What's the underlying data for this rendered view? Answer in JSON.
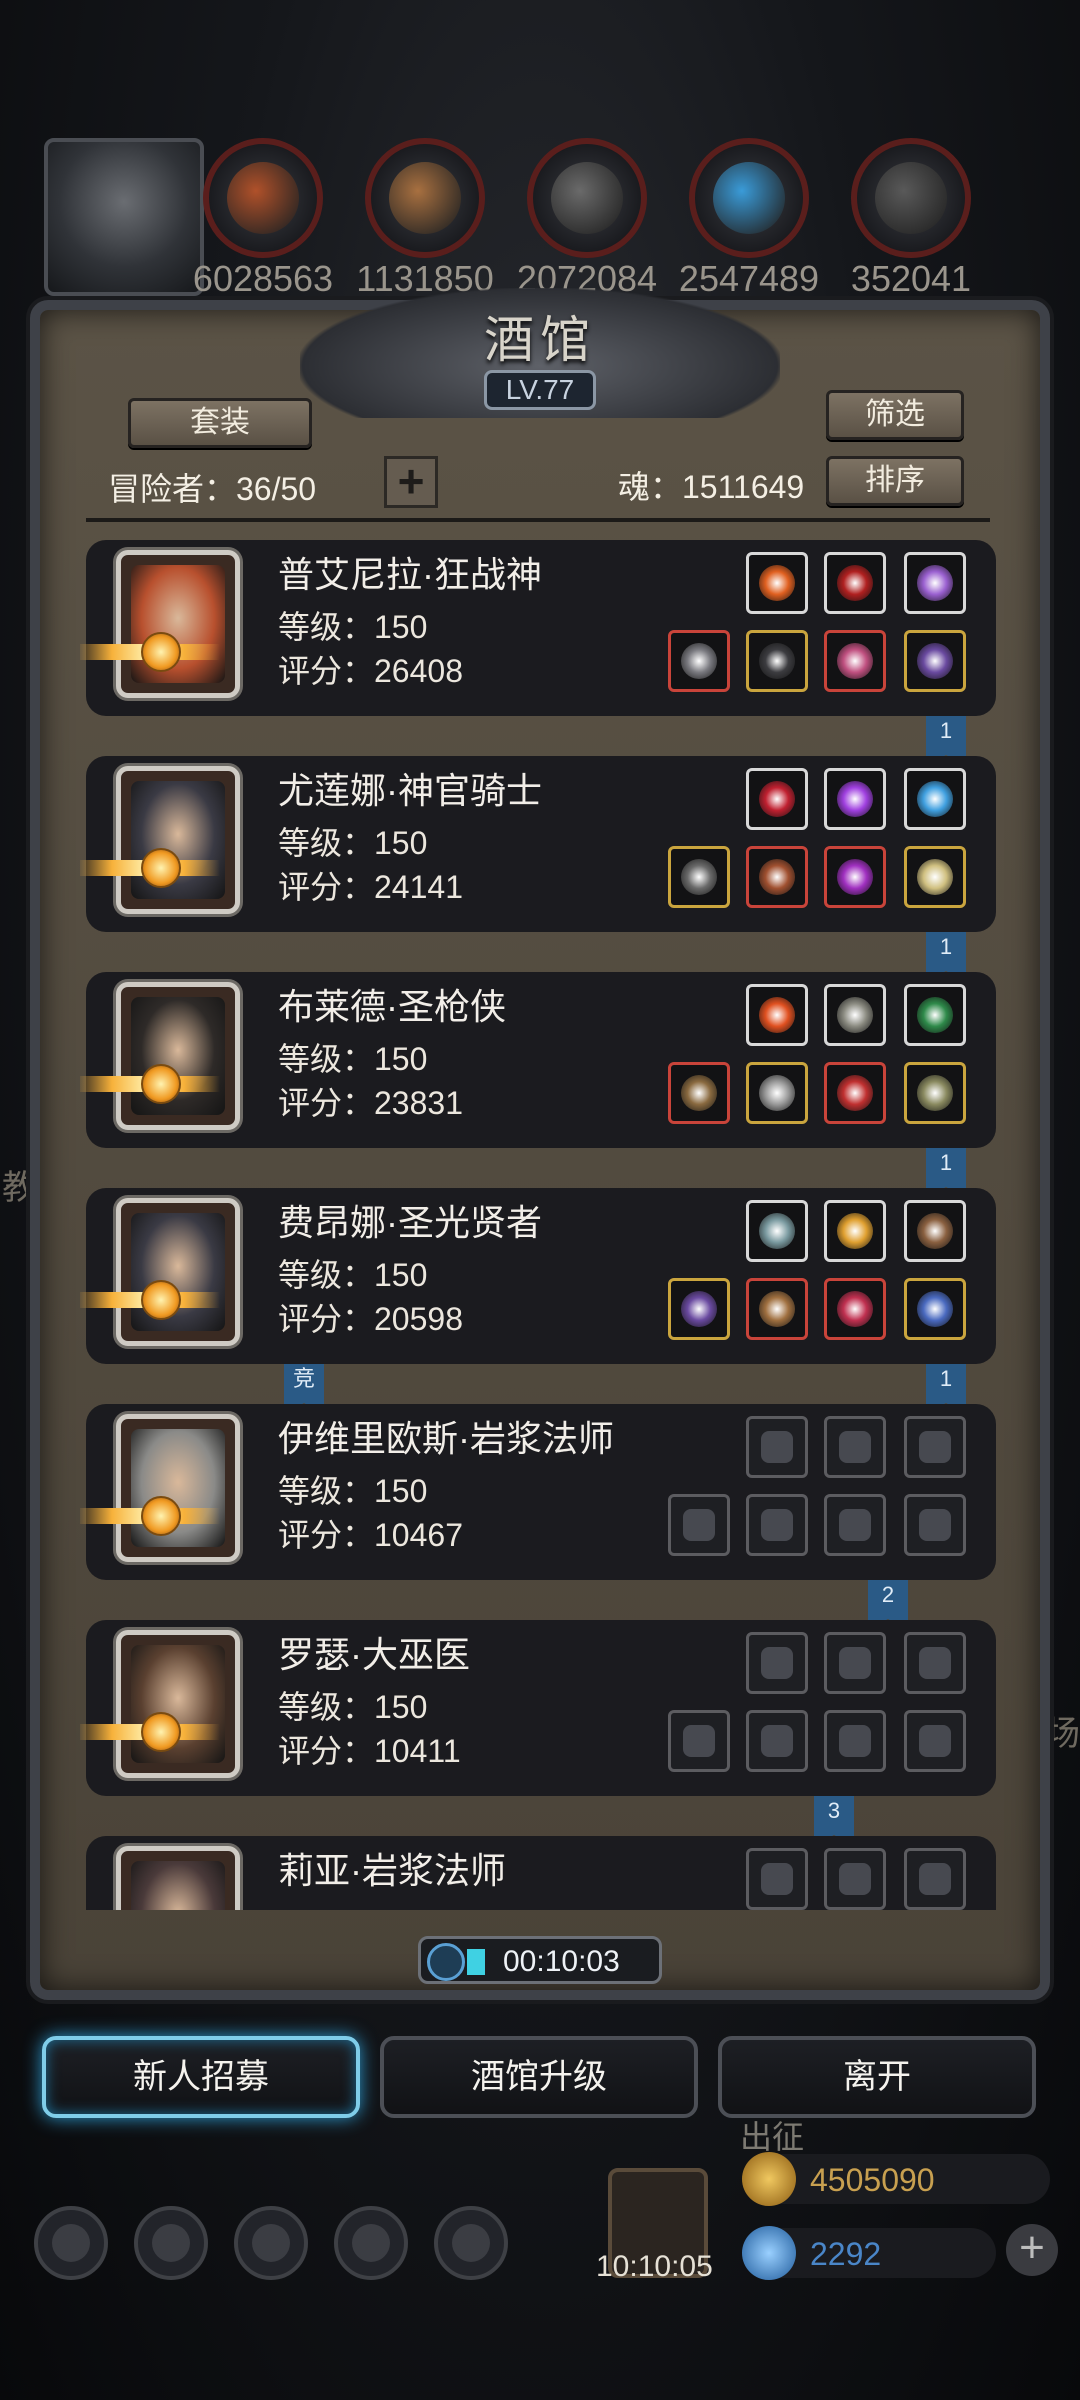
{
  "resources": [
    {
      "name": "leather-resource-icon",
      "value": "6028563",
      "color": "#b0512a"
    },
    {
      "name": "wood-resource-icon",
      "value": "1131850",
      "color": "#a87040"
    },
    {
      "name": "iron-resource-icon",
      "value": "2072084",
      "color": "#6a6a6a"
    },
    {
      "name": "crystal-resource-icon",
      "value": "2547489",
      "color": "#3a9bd8"
    },
    {
      "name": "steel-resource-icon",
      "value": "352041",
      "color": "#595959"
    }
  ],
  "panel": {
    "title": "酒馆",
    "level": "LV.77",
    "set_button": "套装",
    "filter_button": "筛选",
    "sort_button": "排序",
    "adventurers_label": "冒险者：36/50",
    "plus": "+",
    "soul_label": "魂：1511649"
  },
  "heroes": [
    {
      "name": "普艾尼拉·狂战神",
      "level": "等级：150",
      "score": "评分：26408",
      "bookmark": "1",
      "bookmark_left": null,
      "portrait_color": "#b8502e",
      "top_slots": [
        {
          "c": "white",
          "g": "#e06020"
        },
        {
          "c": "white",
          "g": "#b02020"
        },
        {
          "c": "white",
          "g": "#9a60d0"
        }
      ],
      "bottom_slots": [
        {
          "c": "red",
          "g": "#7a7a80"
        },
        {
          "c": "gold",
          "g": "#3c3c40"
        },
        {
          "c": "red",
          "g": "#c05080"
        },
        {
          "c": "gold",
          "g": "#6a4aa0"
        }
      ]
    },
    {
      "name": "尤莲娜·神官骑士",
      "level": "等级：150",
      "score": "评分：24141",
      "bookmark": "1",
      "bookmark_left": null,
      "portrait_color": "#3a3a44",
      "top_slots": [
        {
          "c": "white",
          "g": "#c02030"
        },
        {
          "c": "white",
          "g": "#a040e0"
        },
        {
          "c": "white",
          "g": "#40a0e0"
        }
      ],
      "bottom_slots": [
        {
          "c": "gold",
          "g": "#6a6a6a"
        },
        {
          "c": "red",
          "g": "#a05030"
        },
        {
          "c": "red",
          "g": "#a030c0"
        },
        {
          "c": "gold",
          "g": "#d0c080"
        }
      ]
    },
    {
      "name": "布莱德·圣枪侠",
      "level": "等级：150",
      "score": "评分：23831",
      "bookmark": "1",
      "bookmark_left": null,
      "portrait_color": "#2e2a28",
      "top_slots": [
        {
          "c": "white",
          "g": "#e05020"
        },
        {
          "c": "white",
          "g": "#8a8a80"
        },
        {
          "c": "white",
          "g": "#2e8a4a"
        }
      ],
      "bottom_slots": [
        {
          "c": "red",
          "g": "#8a6a40"
        },
        {
          "c": "gold",
          "g": "#9a9a9a"
        },
        {
          "c": "red",
          "g": "#c03030"
        },
        {
          "c": "gold",
          "g": "#8a8a60"
        }
      ]
    },
    {
      "name": "费昂娜·圣光贤者",
      "level": "等级：150",
      "score": "评分：20598",
      "bookmark": "1",
      "bookmark_left": "竞",
      "portrait_color": "#3a3a44",
      "top_slots": [
        {
          "c": "white",
          "g": "#7a9aa0"
        },
        {
          "c": "white",
          "g": "#e0a030"
        },
        {
          "c": "white",
          "g": "#8a6040"
        }
      ],
      "bottom_slots": [
        {
          "c": "gold",
          "g": "#6a4aa0"
        },
        {
          "c": "red",
          "g": "#a07040"
        },
        {
          "c": "red",
          "g": "#c03050"
        },
        {
          "c": "gold",
          "g": "#4a6ac0"
        }
      ]
    },
    {
      "name": "伊维里欧斯·岩浆法师",
      "level": "等级：150",
      "score": "评分：10467",
      "bookmark": "2",
      "bookmark_left": null,
      "portrait_color": "#8a8a88",
      "top_slots": [
        {
          "c": "empty"
        },
        {
          "c": "empty"
        },
        {
          "c": "empty"
        }
      ],
      "bottom_slots": [
        {
          "c": "empty"
        },
        {
          "c": "empty"
        },
        {
          "c": "empty"
        },
        {
          "c": "empty"
        }
      ]
    },
    {
      "name": "罗瑟·大巫医",
      "level": "等级：150",
      "score": "评分：10411",
      "bookmark": "3",
      "bookmark_left": null,
      "portrait_color": "#5a4030",
      "top_slots": [
        {
          "c": "empty"
        },
        {
          "c": "empty"
        },
        {
          "c": "empty"
        }
      ],
      "bottom_slots": [
        {
          "c": "empty"
        },
        {
          "c": "empty"
        },
        {
          "c": "empty"
        },
        {
          "c": "empty"
        }
      ]
    },
    {
      "name": "莉亚·岩浆法师",
      "level": "",
      "score": "",
      "bookmark": null,
      "bookmark_left": null,
      "portrait_color": "#4a3a3a",
      "top_slots": [
        {
          "c": "empty"
        },
        {
          "c": "empty"
        },
        {
          "c": "empty"
        }
      ],
      "bottom_slots": []
    }
  ],
  "timer": "00:10:03",
  "actions": {
    "recruit": "新人招募",
    "upgrade": "酒馆升级",
    "leave": "离开"
  },
  "hud": {
    "gift_time": "10:10:05",
    "gold": "4505090",
    "gems": "2292",
    "chuzheng": "出征",
    "side_left": "教",
    "side_right": "场"
  },
  "colors": {
    "accent_blue": "#2a5a86",
    "glow": "#7fcde9",
    "gold_text": "#c8a050",
    "gem_text": "#4a86c8"
  }
}
